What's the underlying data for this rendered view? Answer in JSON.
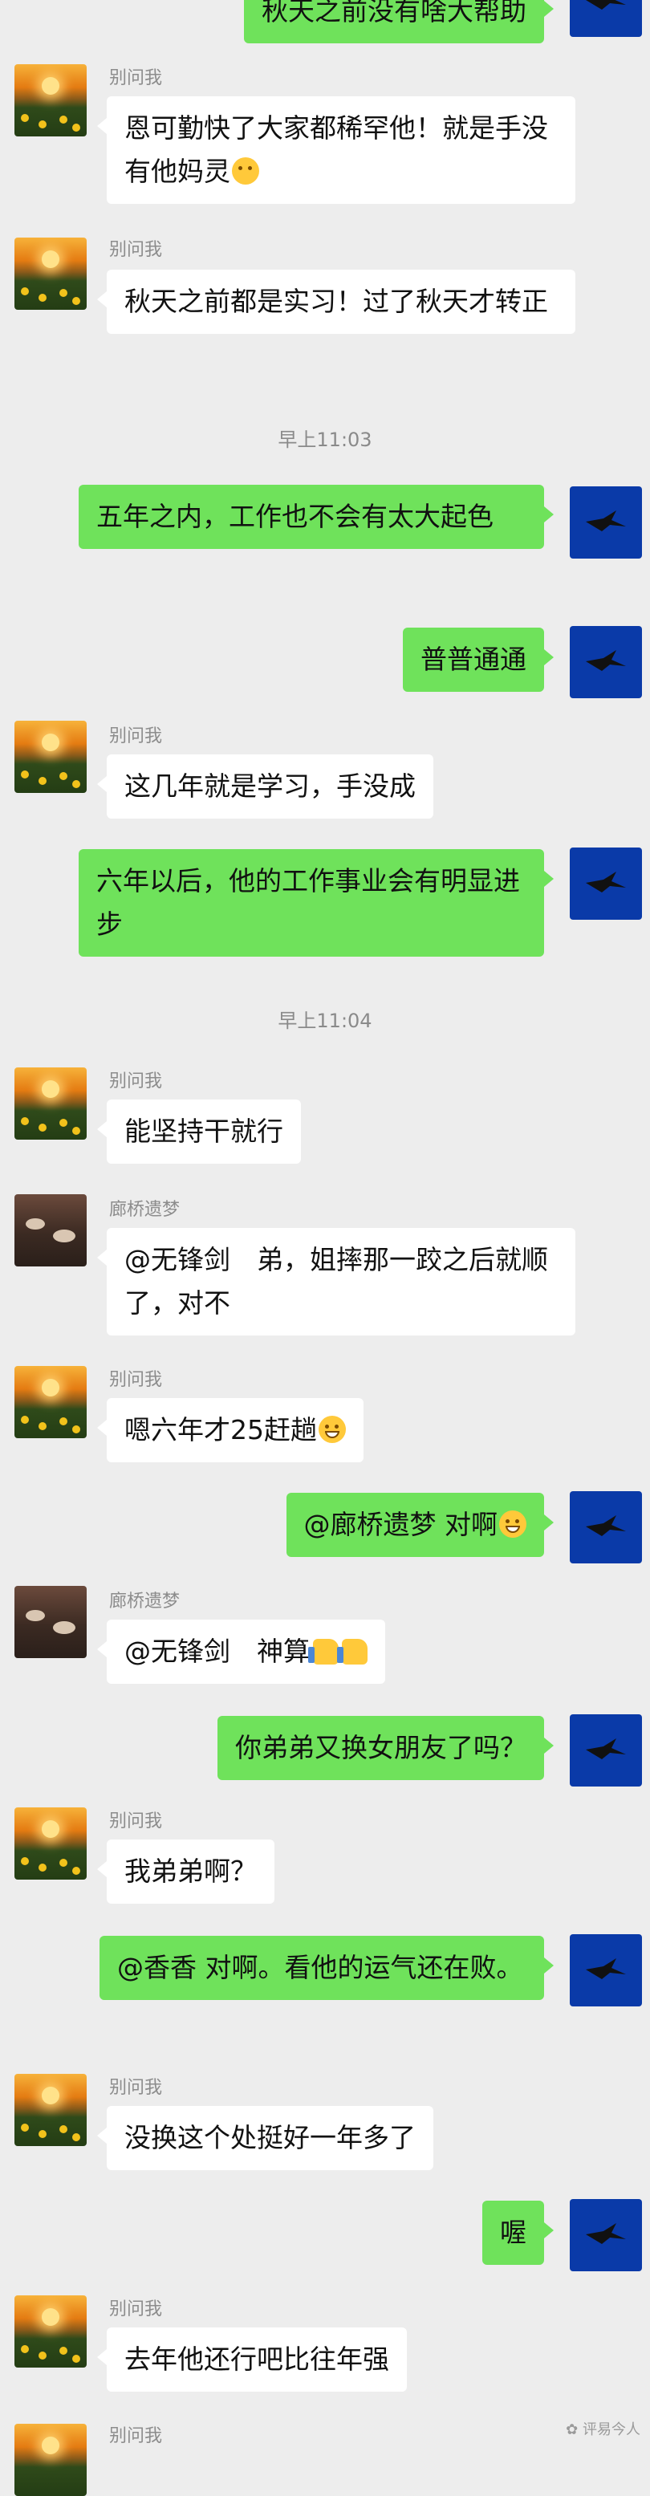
{
  "sender_name": "别问我",
  "other_name": "廊桥遗梦",
  "messages": {
    "m0": "秋天之前没有啥大帮助",
    "m1": "恩可勤快了大家都稀罕他！就是手没有他妈灵",
    "m2": "秋天之前都是实习！过了秋天才转正",
    "t1": "早上11:03",
    "m3": "五年之内，工作也不会有太大起色",
    "m4": "普普通通",
    "m5": "这几年就是学习，手没成",
    "m6": "六年以后，他的工作事业会有明显进步",
    "t2": "早上11:04",
    "m7": "能坚持干就行",
    "m8": "@无锋剑　弟，姐摔那一跤之后就顺了，对不",
    "m9": "嗯六年才25赶趟",
    "m10": "@廊桥遗梦  对啊",
    "m11": "@无锋剑　神算",
    "m12": "你弟弟又换女朋友了吗？",
    "m13": "我弟弟啊？",
    "m14": "@香香  对啊。看他的运气还在败。",
    "m15": "没换这个处挺好一年多了",
    "m16": "喔",
    "m17": "去年他还行吧比往年强"
  },
  "watermark": "评易今人",
  "icons": {
    "sender_avatar": "sunflower-sunset-avatar",
    "other_avatar": "tea-cups-avatar",
    "self_avatar": "bird-avatar",
    "emoji_grin": "grin-emoji-icon",
    "emoji_think": "thinking-emoji-icon",
    "emoji_thumb": "thumbs-up-emoji-icon"
  },
  "colors": {
    "background": "#ededed",
    "outgoing_bubble": "#6fe25b",
    "incoming_bubble": "#ffffff",
    "self_avatar_bg": "#0a3aa8"
  }
}
